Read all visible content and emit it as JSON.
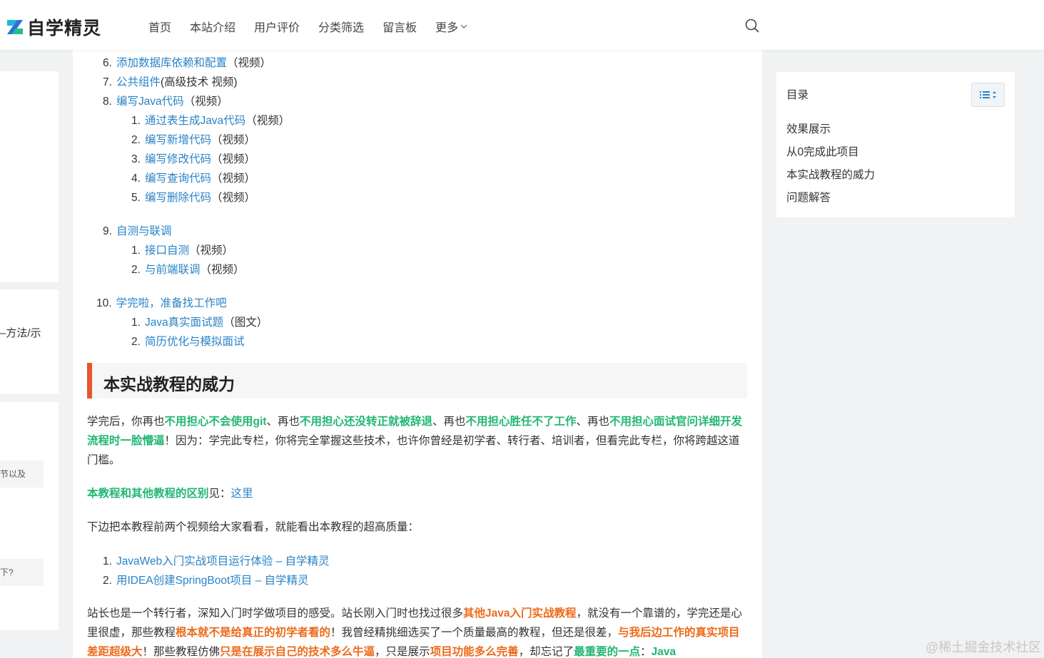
{
  "header": {
    "logo_text": "自学精灵",
    "nav": [
      "首页",
      "本站介绍",
      "用户评价",
      "分类筛选",
      "留言板",
      "更多"
    ]
  },
  "left": {
    "snippet1": "–方法/示",
    "snippet2": "节以及",
    "snippet3": "下?"
  },
  "list_items": [
    {
      "num": "6.",
      "link": "添加数据库依赖和配置",
      "tail": "（视频）"
    },
    {
      "num": "7.",
      "link": "公共组件",
      "tail": "(高级技术 视频)"
    },
    {
      "num": "8.",
      "link": "编写Java代码",
      "tail": "（视频）"
    },
    {
      "num": "1.",
      "link": "通过表生成Java代码",
      "tail": "（视频）"
    },
    {
      "num": "2.",
      "link": "编写新增代码",
      "tail": "（视频）"
    },
    {
      "num": "3.",
      "link": "编写修改代码",
      "tail": "（视频）"
    },
    {
      "num": "4.",
      "link": "编写查询代码",
      "tail": "（视频）"
    },
    {
      "num": "5.",
      "link": "编写删除代码",
      "tail": "（视频）"
    },
    {
      "num": "9.",
      "link": "自测与联调",
      "tail": ""
    },
    {
      "num": "1.",
      "link": "接口自测",
      "tail": "（视频）"
    },
    {
      "num": "2.",
      "link": "与前端联调",
      "tail": "（视频）"
    },
    {
      "num": "10.",
      "link": "学完啦，准备找工作吧",
      "tail": ""
    },
    {
      "num": "1.",
      "link": "Java真实面试题",
      "tail": "（图文）"
    },
    {
      "num": "2.",
      "link": "简历优化与模拟面试",
      "tail": ""
    }
  ],
  "section_title": "本实战教程的威力",
  "p1": {
    "t1": "学完后，你再也",
    "g1": "不用担心不会使用git",
    "t2": "、再也",
    "g2": "不用担心还没转正就被辞退",
    "t3": "、再也",
    "g3": "不用担心胜任不了工作",
    "t4": "、再也",
    "g4": "不用担心面试官问详细开发流程时一脸懵逼",
    "t5": "！因为：学完此专栏，你将完全掌握这些技术，也许你曾经是初学者、转行者、培训者，但看完此专栏，你将跨越这道门槛。"
  },
  "p2": {
    "g": "本教程和其他教程的区别",
    "t": "见：",
    "link": "这里"
  },
  "p3": "下边把本教程前两个视频给大家看看，就能看出本教程的超高质量：",
  "videos": [
    {
      "num": "1.",
      "link": "JavaWeb入门实战项目运行体验 – 自学精灵"
    },
    {
      "num": "2.",
      "link": "用IDEA创建SpringBoot项目 – 自学精灵"
    }
  ],
  "p4": {
    "t1": "站长也是一个转行者，深知入门时学做项目的感受。站长刚入门时也找过很多",
    "o1": "其他Java入门实战教程",
    "t2": "，就没有一个靠谱的，学完还是心里很虚，那些教程",
    "o2": "根本就不是给真正的初学者看的",
    "t3": "！我曾经精挑细选买了一个质量最高的教程，但还是很差，",
    "o3": "与我后边工作的真实项目差距超级大",
    "t4": "！那些教程仿佛",
    "o4": "只是在展示自己的技术多么牛逼",
    "t5": "，只是展示",
    "o5": "项目功能多么完善",
    "t6": "，却忘记了",
    "g1": "最重要的一点",
    "t7": "：",
    "g2": "Java"
  },
  "toc": {
    "title": "目录",
    "items": [
      "效果展示",
      "从0完成此项目",
      "本实战教程的威力",
      "问题解答"
    ]
  },
  "watermark": "@稀土掘金技术社区",
  "colors": {
    "link": "#2a83c7",
    "green": "#21b673",
    "orange": "#ec6a1a",
    "accent_bar": "#e8552e"
  }
}
